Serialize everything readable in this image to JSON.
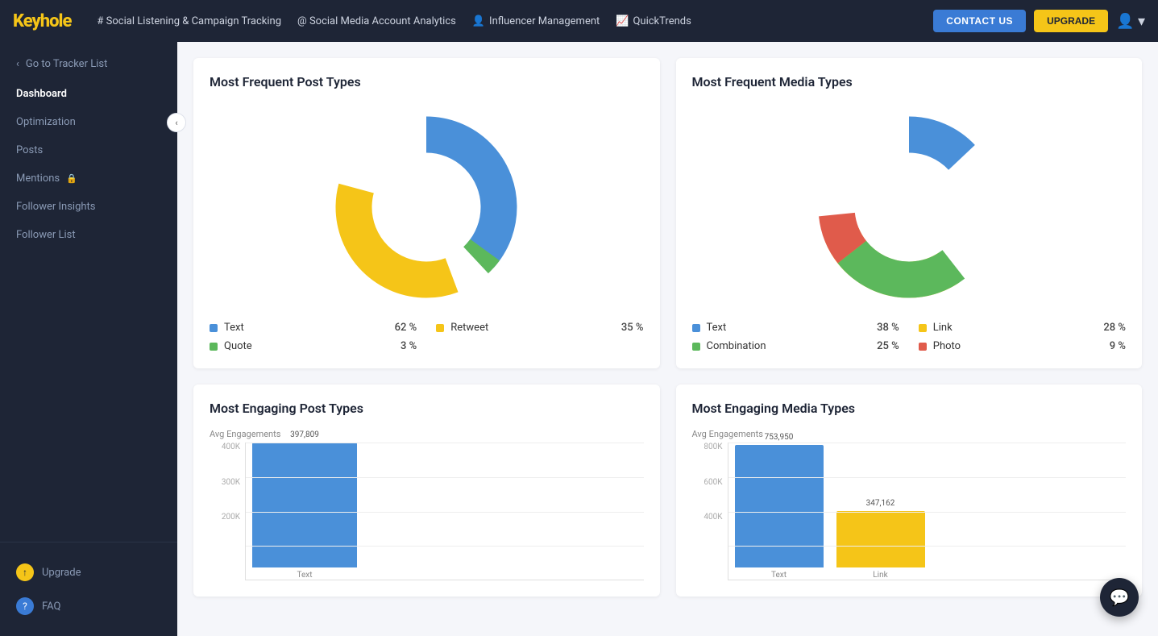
{
  "brand": {
    "name_yellow": "Keyhole",
    "tagline": ""
  },
  "topnav": {
    "social_listening": "# Social Listening & Campaign Tracking",
    "social_media": "@ Social Media Account Analytics",
    "influencer": "Influencer Management",
    "quicktrends": "QuickTrends",
    "contact_label": "CONTACT US",
    "upgrade_label": "UPGRADE"
  },
  "sidebar": {
    "back_label": "Go to Tracker List",
    "items": [
      {
        "label": "Dashboard",
        "active": true
      },
      {
        "label": "Optimization",
        "active": false
      },
      {
        "label": "Posts",
        "active": false
      },
      {
        "label": "Mentions",
        "active": false,
        "locked": true
      },
      {
        "label": "Follower Insights",
        "active": false
      },
      {
        "label": "Follower List",
        "active": false
      }
    ],
    "bottom": [
      {
        "label": "Upgrade",
        "icon": "upgrade"
      },
      {
        "label": "FAQ",
        "icon": "faq"
      }
    ]
  },
  "post_types_donut": {
    "title": "Most Frequent Post Types",
    "segments": [
      {
        "label": "Text",
        "pct": 62,
        "color": "#4a90d9",
        "start": 0,
        "span": 0.62
      },
      {
        "label": "Retweet",
        "pct": 35,
        "color": "#f5c518",
        "start": 0.62,
        "span": 0.35
      },
      {
        "label": "Quote",
        "pct": 3,
        "color": "#5cb85c",
        "start": 0.97,
        "span": 0.03
      }
    ]
  },
  "media_types_donut": {
    "title": "Most Frequent Media Types",
    "segments": [
      {
        "label": "Text",
        "pct": 38,
        "color": "#4a90d9",
        "start": 0,
        "span": 0.38
      },
      {
        "label": "Link",
        "pct": 28,
        "color": "#f5c518",
        "start": 0.38,
        "span": 0.28
      },
      {
        "label": "Combination",
        "pct": 25,
        "color": "#5cb85c",
        "start": 0.66,
        "span": 0.25
      },
      {
        "label": "Photo",
        "pct": 9,
        "color": "#e05b4b",
        "start": 0.91,
        "span": 0.09
      }
    ]
  },
  "engaging_post_types": {
    "title": "Most Engaging Post Types",
    "y_label": "Avg Engagements",
    "y_ticks": [
      "400K",
      "300K",
      "200K"
    ],
    "bars": [
      {
        "label": "Text",
        "value": 397809,
        "display": "397,809",
        "color": "#4a90d9",
        "height_pct": 0.97
      }
    ]
  },
  "engaging_media_types": {
    "title": "Most Engaging Media Types",
    "y_label": "Avg Engagements",
    "y_ticks": [
      "800K",
      "600K",
      "400K"
    ],
    "bars": [
      {
        "label": "Text",
        "value": 753950,
        "display": "753,950",
        "color": "#4a90d9",
        "height_pct": 0.94
      },
      {
        "label": "Link",
        "value": 347162,
        "display": "347,162",
        "color": "#f5c518",
        "height_pct": 0.43
      }
    ]
  }
}
